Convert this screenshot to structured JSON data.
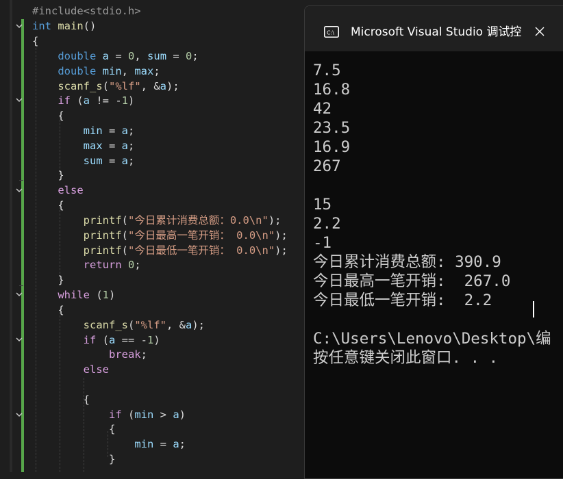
{
  "editor": {
    "lines": [
      "#include<stdio.h>",
      "int main()",
      "{",
      "    double a = 0, sum = 0;",
      "    double min, max;",
      "    scanf_s(\"%lf\", &a);",
      "    if (a != -1)",
      "    {",
      "        min = a;",
      "        max = a;",
      "        sum = a;",
      "    }",
      "    else",
      "    {",
      "        printf(\"今日累计消费总额：0.0\\n\");",
      "        printf(\"今日最高一笔开销： 0.0\\n\");",
      "        printf(\"今日最低一笔开销： 0.0\\n\");",
      "        return 0;",
      "    }",
      "    while (1)",
      "    {",
      "        scanf_s(\"%lf\", &a);",
      "        if (a == -1)",
      "            break;",
      "        else",
      "        ",
      "        {",
      "            if (min > a)",
      "            {",
      "                min = a;",
      "            }"
    ]
  },
  "console": {
    "title": "Microsoft Visual Studio 调试控制台",
    "icon": "console-icon",
    "close_icon": "close-icon",
    "output": [
      "7.5",
      "16.8",
      "42",
      "23.5",
      "16.9",
      "267",
      "",
      "15",
      "2.2",
      "-1",
      "今日累计消费总额: 390.9",
      "今日最高一笔开销:  267.0",
      "今日最低一笔开销:  2.2",
      "",
      "C:\\Users\\Lenovo\\Desktop\\编",
      "按任意键关闭此窗口. . ."
    ]
  },
  "colors": {
    "editor_background": "#1e1e1e",
    "console_background": "#0c0c0c",
    "change_bar": "#57a64a",
    "keyword": "#569cd6",
    "control_keyword": "#d8a0df",
    "function": "#dcdcaa",
    "variable": "#9cdcfe",
    "string": "#d69d85",
    "number": "#b5cea8"
  }
}
